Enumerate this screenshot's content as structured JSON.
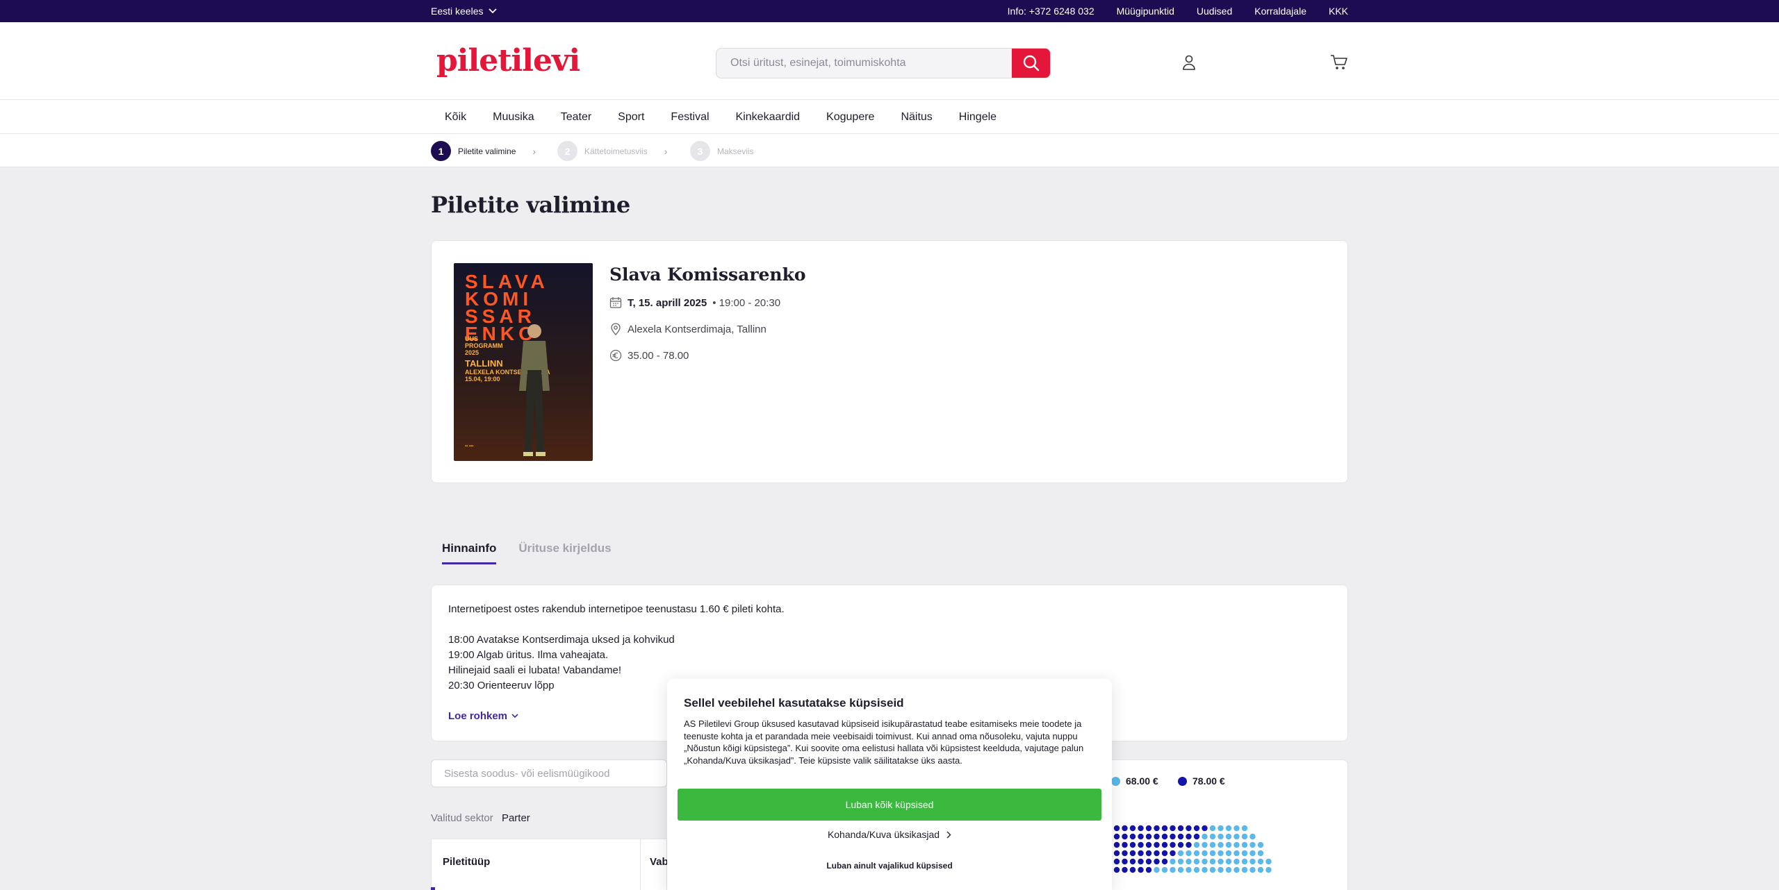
{
  "topbar": {
    "language": "Eesti keeles",
    "links": [
      "Info: +372 6248 032",
      "Müügipunktid",
      "Uudised",
      "Korraldajale",
      "KKK"
    ]
  },
  "header": {
    "logo": "piletilevi",
    "search_placeholder": "Otsi üritust, esinejat, toimumiskohta"
  },
  "nav": {
    "items": [
      "Kõik",
      "Muusika",
      "Teater",
      "Sport",
      "Festival",
      "Kinkekaardid",
      "Kogupere",
      "Näitus",
      "Hingele"
    ]
  },
  "steps": [
    {
      "num": "1",
      "label": "Piletite valimine"
    },
    {
      "num": "2",
      "label": "Kättetoimetusviis"
    },
    {
      "num": "3",
      "label": "Makseviis"
    }
  ],
  "page": {
    "title": "Piletite valimine"
  },
  "event": {
    "title": "Slava Komissarenko",
    "date": "T, 15. aprill 2025",
    "time": "• 19:00 - 20:30",
    "venue": "Alexela Kontserdimaja, Tallinn",
    "price_range": "35.00 - 78.00",
    "poster": {
      "title_lines": [
        "SLAVA",
        "KOMI",
        "SSAR",
        "ENKO"
      ],
      "program_lines": [
        "UUS",
        "PROGRAMM",
        "2025"
      ],
      "city": "TALLINN",
      "details_lines": [
        "ALEXELA KONTSERDIMAJA",
        "15.04, 19:00"
      ]
    }
  },
  "tabs": {
    "price_info": "Hinnainfo",
    "description": "Ürituse kirjeldus"
  },
  "info": {
    "fee_line": "Internetipoest ostes rakendub internetipoe teenustasu 1.60 € pileti kohta.",
    "schedule": [
      "18:00 Avatakse Kontserdimaja uksed ja kohvikud",
      "19:00 Algab üritus. Ilma vaheajata.",
      "Hilinejaid saali ei lubata! Vabandame!",
      "20:30 Orienteeruv lõpp"
    ],
    "read_more": "Loe rohkem"
  },
  "promo": {
    "placeholder": "Sisesta soodus- või eelismüügikood"
  },
  "sector": {
    "label": "Valitud sektor",
    "value": "Parter"
  },
  "ticket_table": {
    "col_type": "Piletitüüp",
    "col_second": "Vab"
  },
  "price_legend": [
    {
      "price": "68.00 €",
      "color": "#5bb8e8"
    },
    {
      "price": "78.00 €",
      "color": "#1414a8"
    }
  ],
  "cookie": {
    "title": "Sellel veebilehel kasutatakse küpsiseid",
    "body": "AS Piletilevi Group üksused kasutavad küpsiseid isikupärastatud teabe esitamiseks meie toodete ja teenuste kohta ja et parandada meie veebisaidi toimivust. Kui annad oma nõusoleku, vajuta nuppu „Nõustun kõigi küpsistega”. Kui soovite oma eelistusi hallata või küpsistest keelduda, vajutage palun „Kohanda/Kuva üksikasjad”. Teie küpsiste valik säilitatakse üks aasta.",
    "accept_all": "Luban kõik küpsised",
    "customize": "Kohanda/Kuva üksikasjad",
    "necessary_only": "Luban ainult vajalikud küpsised"
  },
  "colors": {
    "topbar": "#1d0c52",
    "brand_red": "#e4173a",
    "accent_purple": "#4327a8",
    "accept_green": "#3ab93e"
  }
}
